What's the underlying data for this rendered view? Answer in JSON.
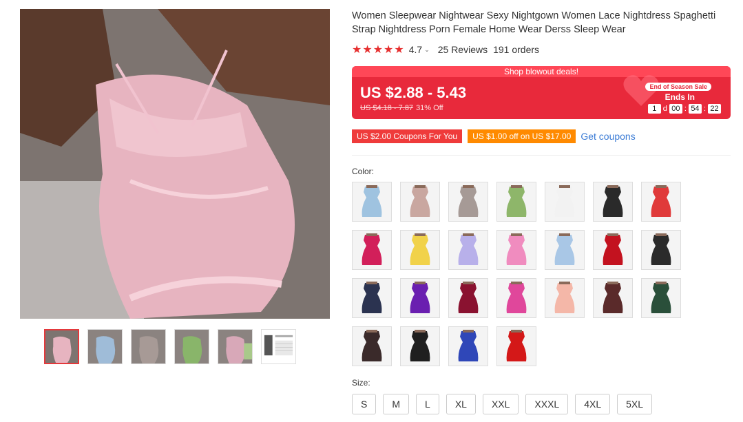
{
  "product": {
    "title": "Women Sleepwear Nightwear Sexy Nightgown Women Lace Nightdress Spaghetti Strap Nightdress Porn Female Home Wear Derss Sleep Wear",
    "stars": "★★★★★",
    "rating": "4.7",
    "reviews": "25 Reviews",
    "orders": "191 orders"
  },
  "deal": {
    "banner": "Shop blowout deals!",
    "price": "US $2.88 - 5.43",
    "old_price": "US $4.18 - 7.87",
    "discount": "31% Off",
    "season_tag": "End of Season Sale",
    "ends_in": "Ends In",
    "countdown": {
      "days": "1",
      "d_label": "d",
      "hours": "00",
      "minutes": "54",
      "seconds": "22",
      "sep": ":"
    }
  },
  "coupons": {
    "coupon1": "US $2.00 Coupons For You",
    "coupon2": "US $1.00 off on US $17.00",
    "get": "Get coupons"
  },
  "color_label": "Color:",
  "size_label": "Size:",
  "sizes": [
    "S",
    "M",
    "L",
    "XL",
    "XXL",
    "XXXL",
    "4XL",
    "5XL"
  ],
  "colors": {
    "accent_red": "#e8293b",
    "coupon_orange": "#ff8a00",
    "link_blue": "#3a7bd5"
  }
}
